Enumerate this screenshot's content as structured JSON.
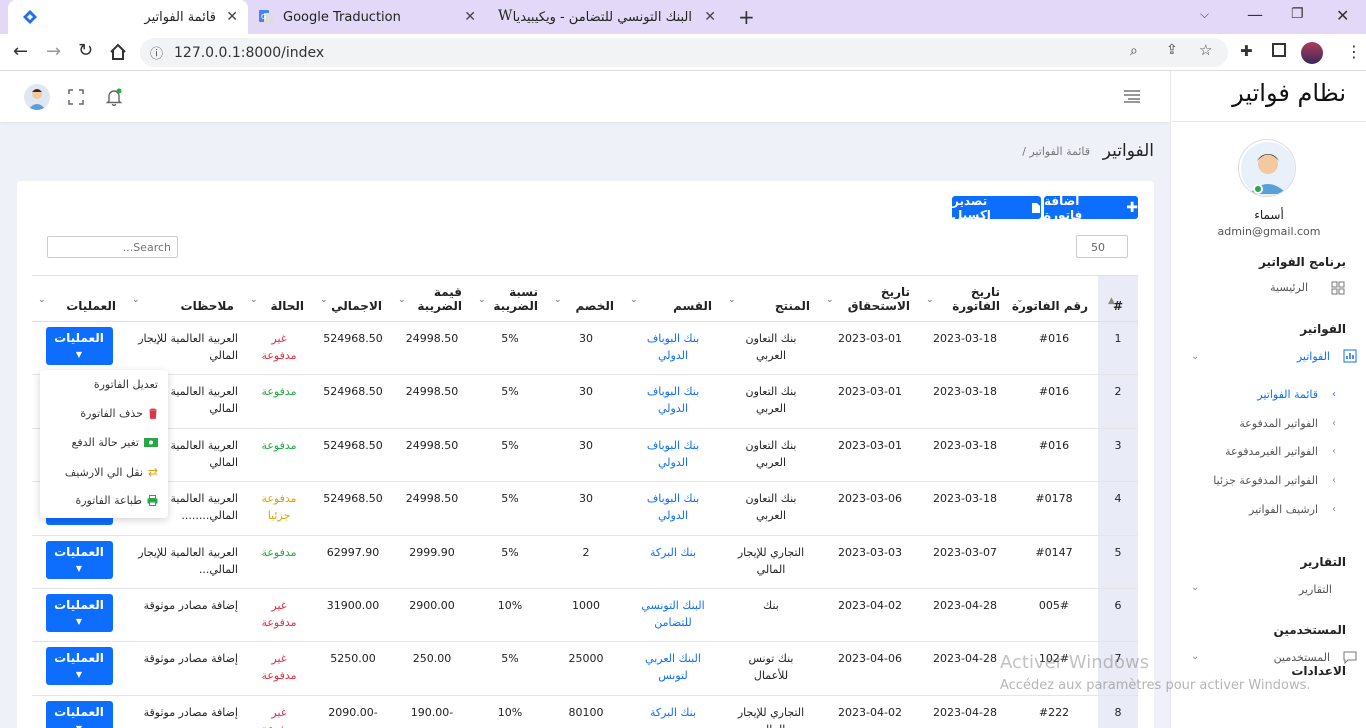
{
  "browser": {
    "tabs": [
      {
        "title": "قائمة الفواتير"
      },
      {
        "title": "Google Traduction"
      },
      {
        "title": "البنك التونسي للتضامن - ويكيبيديا"
      }
    ],
    "url": "127.0.0.1:8000/index"
  },
  "app": {
    "brand": "نظام فواتير",
    "user": {
      "name": "أسماء",
      "email": "admin@gmail.com"
    }
  },
  "sidebar": {
    "program_heading": "برنامج الفواتير",
    "home": "الرئيسية",
    "invoices_heading": "الفواتير",
    "invoices": "الفواتير",
    "sub": [
      "قائمة الفواتير",
      "الفواتير المدفوعة",
      "الفواتير الغيرمدفوعة",
      "الفواتير المدفوعة جزئيا",
      "ارشيف الفواتير"
    ],
    "reports_heading": "التقارير",
    "reports": "التقارير",
    "users_heading": "المستخدمين",
    "users": "المستخدمين",
    "settings_heading": "الاعدادات"
  },
  "page": {
    "title": "الفواتير",
    "breadcrumb": "/ قائمة الفواتير",
    "add_button": "اضافة فاتورة",
    "export_button": "تصدير اكسيل",
    "page_size": "50",
    "search_placeholder": "Search..."
  },
  "table": {
    "headers": [
      "#",
      "رقم الفاتورة",
      "تاريخ الفاتورة",
      "تاريخ الاستحقاق",
      "المنتج",
      "القسم",
      "الخصم",
      "نسبة الضريبة",
      "قيمة الضريبة",
      "الاجمالي",
      "الحالة",
      "ملاحظات",
      "العمليات"
    ],
    "op_label": "العمليات",
    "rows": [
      {
        "n": "1",
        "num": "#016",
        "date": "2023-03-18",
        "due": "2023-03-01",
        "product": "بنك التعاون العربي",
        "section": "بنك البوباف الدولي",
        "discount": "30",
        "rate": "5%",
        "tax": "24998.50",
        "total": "524968.50",
        "status": "غير مدفوعة",
        "status_color": "#dc3545",
        "notes": "العربية العالمية للإيجار المالي"
      },
      {
        "n": "2",
        "num": "#016",
        "date": "2023-03-18",
        "due": "2023-03-01",
        "product": "بنك التعاون العربي",
        "section": "بنك البوباف الدولي",
        "discount": "30",
        "rate": "5%",
        "tax": "24998.50",
        "total": "524968.50",
        "status": "مدفوعة",
        "status_color": "#28a745",
        "notes": "العربية العالمية للإيجار المالي"
      },
      {
        "n": "3",
        "num": "#016",
        "date": "2023-03-18",
        "due": "2023-03-01",
        "product": "بنك التعاون العربي",
        "section": "بنك البوباف الدولي",
        "discount": "30",
        "rate": "5%",
        "tax": "24998.50",
        "total": "524968.50",
        "status": "مدفوعة",
        "status_color": "#28a745",
        "notes": "العربية العالمية للإيجار المالي"
      },
      {
        "n": "4",
        "num": "#0178",
        "date": "2023-03-18",
        "due": "2023-03-06",
        "product": "بنك التعاون العربي",
        "section": "بنك البوباف الدولي",
        "discount": "30",
        "rate": "5%",
        "tax": "24998.50",
        "total": "524968.50",
        "status": "مدفوعة جزئيا",
        "status_color": "#e0a000",
        "notes": "العربية العالمية للإيجار المالي........"
      },
      {
        "n": "5",
        "num": "#0147",
        "date": "2023-03-07",
        "due": "2023-03-03",
        "product": "التجاري للإيجار المالي",
        "section": "بنك البركة",
        "discount": "2",
        "rate": "5%",
        "tax": "2999.90",
        "total": "62997.90",
        "status": "مدفوعة",
        "status_color": "#28a745",
        "notes": "العربية العالمية للإيجار المالي..."
      },
      {
        "n": "6",
        "num": "005#",
        "date": "2023-04-28",
        "due": "2023-04-02",
        "product": "بنك",
        "section": "البنك التونسي للتضامن",
        "discount": "1000",
        "rate": "10%",
        "tax": "2900.00",
        "total": "31900.00",
        "status": "غير مدفوعة",
        "status_color": "#dc3545",
        "notes": "إضافة مصادر موثوقة"
      },
      {
        "n": "7",
        "num": "102#",
        "date": "2023-04-28",
        "due": "2023-04-06",
        "product": "بنك تونس للأعمال",
        "section": "البنك العربي لتونس",
        "discount": "25000",
        "rate": "5%",
        "tax": "250.00",
        "total": "5250.00",
        "status": "غير مدفوعة",
        "status_color": "#dc3545",
        "notes": "إضافة مصادر موثوقة"
      },
      {
        "n": "8",
        "num": "#222",
        "date": "2023-04-28",
        "due": "2023-04-02",
        "product": "التجاري للإيجار المالي",
        "section": "بنك البركة",
        "discount": "80100",
        "rate": "10%",
        "tax": "-190.00",
        "total": "-2090.00",
        "status": "غير مدفوعة",
        "status_color": "#dc3545",
        "notes": "إضافة مصادر موثوقة"
      }
    ]
  },
  "dropdown": {
    "items": [
      {
        "label": "تعديل الفاتورة",
        "icon": "edit-icon",
        "color": "#333333"
      },
      {
        "label": "حذف الفاتورة",
        "icon": "trash-icon",
        "color": "#dc3545"
      },
      {
        "label": "تغير حالة الدفع",
        "icon": "money-icon",
        "color": "#28a745"
      },
      {
        "label": "نقل الي الارشيف",
        "icon": "exchange-icon",
        "color": "#e0a000"
      },
      {
        "label": "طباعة الفاتورة",
        "icon": "print-icon",
        "color": "#28a745"
      }
    ]
  },
  "watermark": {
    "title": "Activer Windows",
    "subtitle": "Accédez aux paramètres pour activer Windows."
  }
}
